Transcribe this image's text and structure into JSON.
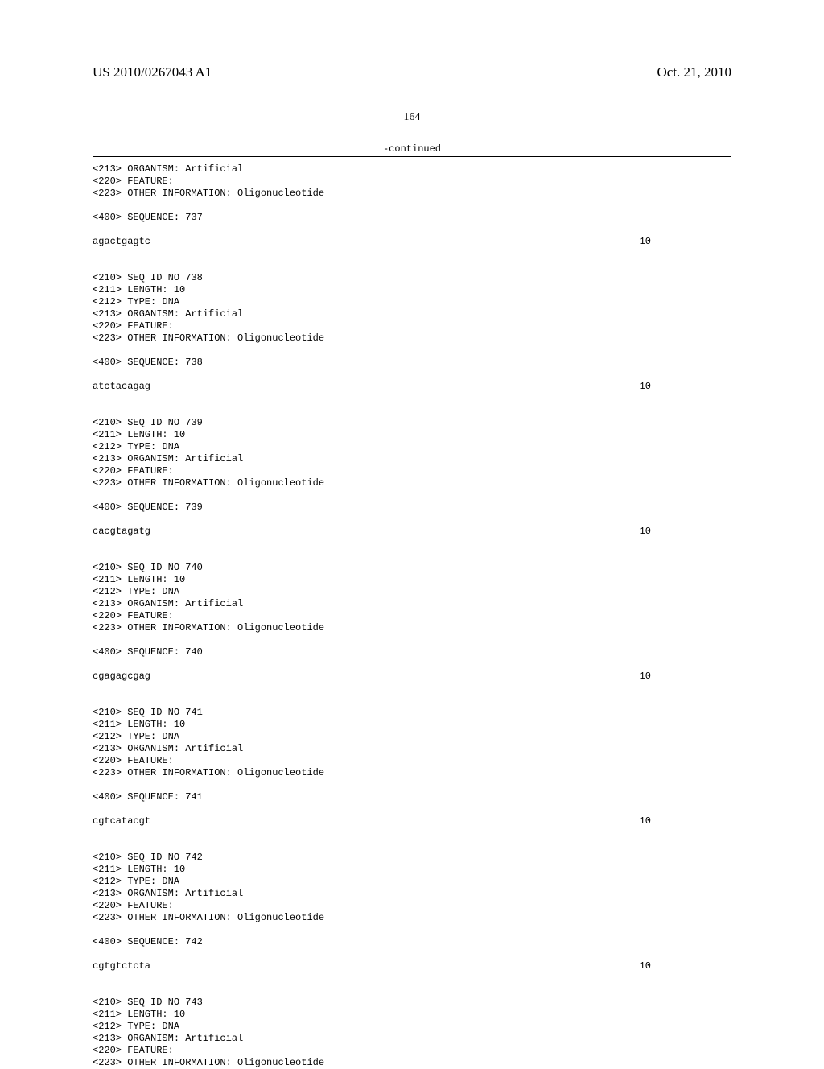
{
  "header": {
    "left": "US 2010/0267043 A1",
    "right": "Oct. 21, 2010"
  },
  "page_number": "164",
  "continued": "-continued",
  "entries": [
    {
      "seq_id": "737",
      "meta_tail": [
        "<213> ORGANISM: Artificial",
        "<220> FEATURE:",
        "<223> OTHER INFORMATION: Oligonucleotide"
      ],
      "sequence": "agactgagtc",
      "length": "10",
      "meta_head": false
    },
    {
      "seq_id": "738",
      "sequence": "atctacagag",
      "length": "10",
      "meta_head": true
    },
    {
      "seq_id": "739",
      "sequence": "cacgtagatg",
      "length": "10",
      "meta_head": true
    },
    {
      "seq_id": "740",
      "sequence": "cgagagcgag",
      "length": "10",
      "meta_head": true
    },
    {
      "seq_id": "741",
      "sequence": "cgtcatacgt",
      "length": "10",
      "meta_head": true
    },
    {
      "seq_id": "742",
      "sequence": "cgtgtctcta",
      "length": "10",
      "meta_head": true
    },
    {
      "seq_id": "743",
      "sequence": "",
      "length": "",
      "meta_head": true,
      "no_sequence": true
    }
  ],
  "meta_template": {
    "seq_id_no": "<210> SEQ ID NO ",
    "length_line": "<211> LENGTH: 10",
    "type_line": "<212> TYPE: DNA",
    "organism_line": "<213> ORGANISM: Artificial",
    "feature_line": "<220> FEATURE:",
    "other_info_line": "<223> OTHER INFORMATION: Oligonucleotide",
    "sequence_line": "<400> SEQUENCE: "
  }
}
